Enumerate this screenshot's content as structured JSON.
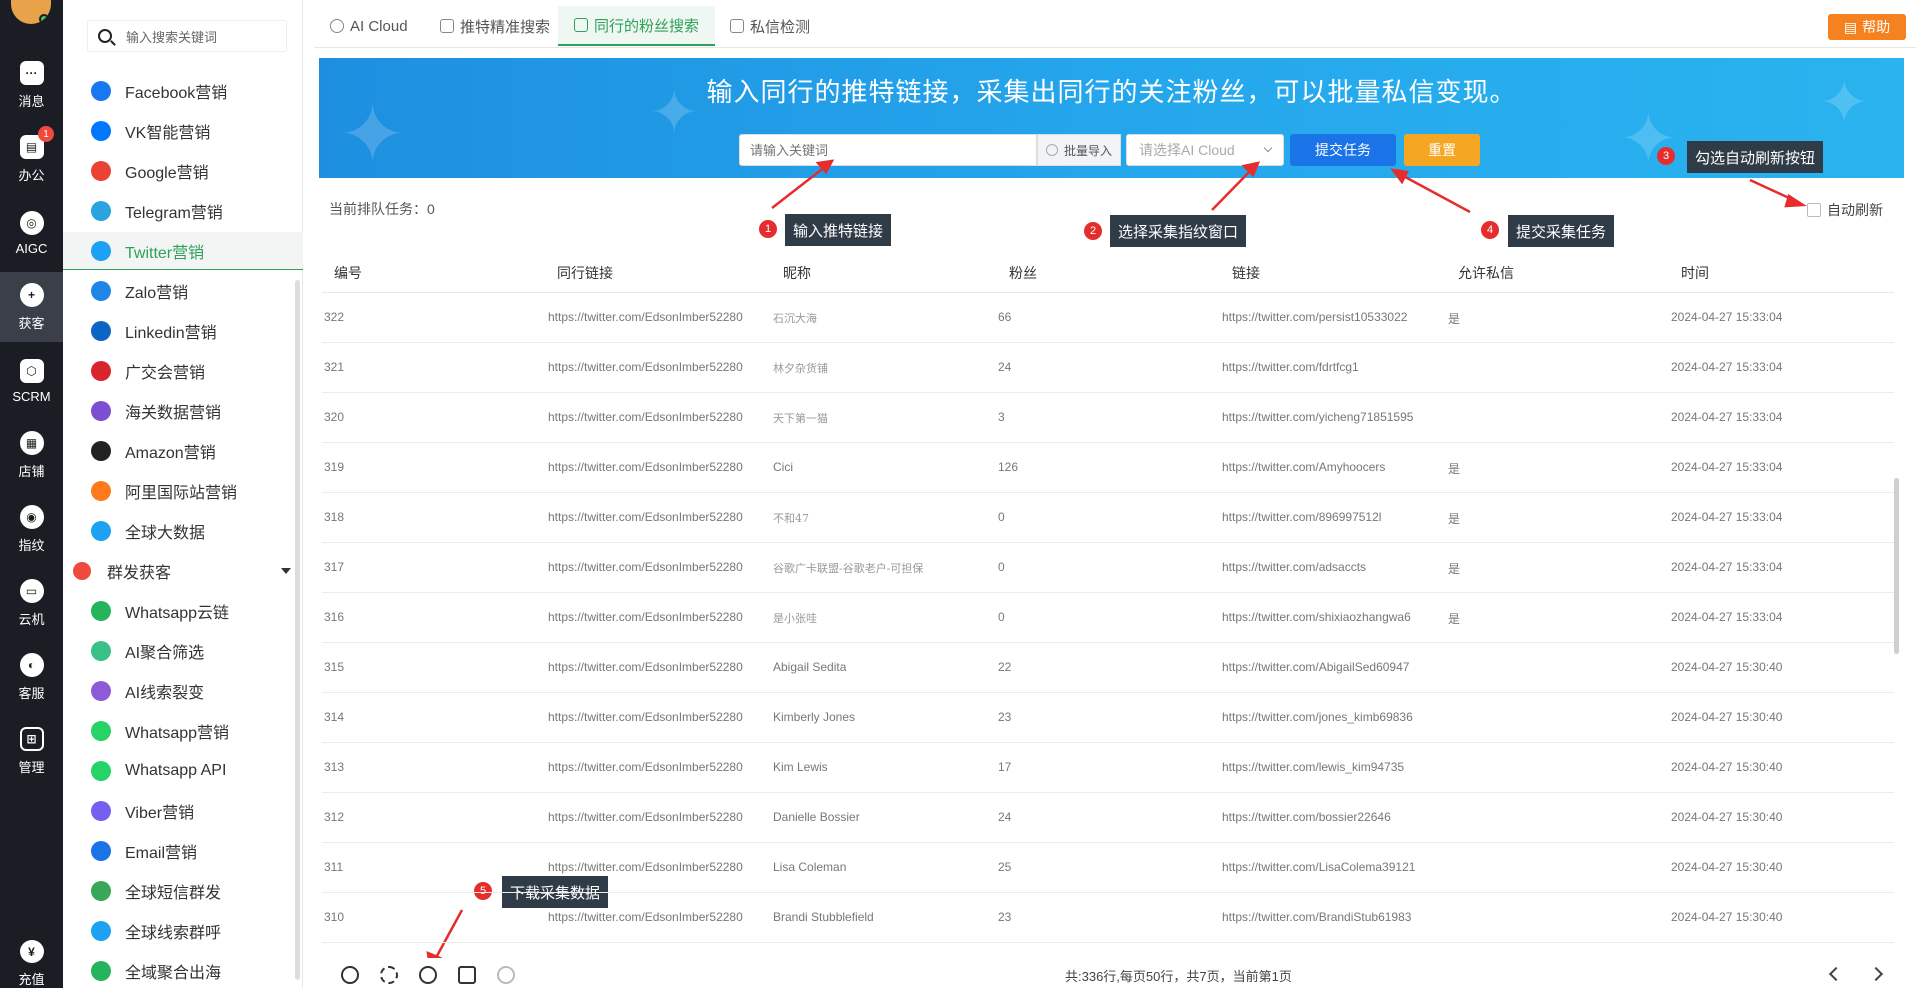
{
  "rail": {
    "items": [
      {
        "label": "消息"
      },
      {
        "label": "办公",
        "badge": "1"
      },
      {
        "label": "AIGC"
      },
      {
        "label": "获客"
      },
      {
        "label": "SCRM"
      },
      {
        "label": "店铺"
      },
      {
        "label": "指纹"
      },
      {
        "label": "云机"
      },
      {
        "label": "客服"
      },
      {
        "label": "管理"
      },
      {
        "label": "充值"
      }
    ]
  },
  "sidebar": {
    "search_placeholder": "输入搜索关键词",
    "items": [
      {
        "label": "Facebook营销",
        "icon": "facebook-icon",
        "color": "#1877f2"
      },
      {
        "label": "VK智能营销",
        "icon": "vk-icon",
        "color": "#0077ff"
      },
      {
        "label": "Google营销",
        "icon": "google-icon",
        "color": "#ea4335"
      },
      {
        "label": "Telegram营销",
        "icon": "telegram-icon",
        "color": "#2aa3df"
      },
      {
        "label": "Twitter营销",
        "icon": "twitter-icon",
        "color": "#1da1f2"
      },
      {
        "label": "Zalo营销",
        "icon": "zalo-icon",
        "color": "#1f86e8"
      },
      {
        "label": "Linkedin营销",
        "icon": "linkedin-icon",
        "color": "#0a66c2"
      },
      {
        "label": "广交会营销",
        "icon": "canton-fair-icon",
        "color": "#d9232d"
      },
      {
        "label": "海关数据营销",
        "icon": "customs-data-icon",
        "color": "#7a4fd4"
      },
      {
        "label": "Amazon营销",
        "icon": "amazon-icon",
        "color": "#222222"
      },
      {
        "label": "阿里国际站营销",
        "icon": "alibaba-icon",
        "color": "#ff7a1a"
      },
      {
        "label": "全球大数据",
        "icon": "big-data-icon",
        "color": "#1da1f2"
      }
    ],
    "group_label": "群发获客",
    "group_items": [
      {
        "label": "Whatsapp云链",
        "icon": "whatsapp-cloud-icon",
        "color": "#25b35c"
      },
      {
        "label": "AI聚合筛选",
        "icon": "ai-filter-icon",
        "color": "#3cc08a"
      },
      {
        "label": "AI线索裂变",
        "icon": "ai-lead-icon",
        "color": "#8e5bd8"
      },
      {
        "label": "Whatsapp营销",
        "icon": "whatsapp-icon",
        "color": "#25d366"
      },
      {
        "label": "Whatsapp API",
        "icon": "whatsapp-api-icon",
        "color": "#25d366"
      },
      {
        "label": "Viber营销",
        "icon": "viber-icon",
        "color": "#7360f2"
      },
      {
        "label": "Email营销",
        "icon": "email-icon",
        "color": "#1a74e8"
      },
      {
        "label": "全球短信群发",
        "icon": "sms-icon",
        "color": "#3aa757"
      },
      {
        "label": "全球线索群呼",
        "icon": "call-icon",
        "color": "#1da1f2"
      },
      {
        "label": "全域聚合出海",
        "icon": "global-icon",
        "color": "#25b35c"
      }
    ]
  },
  "tabs": [
    {
      "label": "AI Cloud"
    },
    {
      "label": "推特精准搜索"
    },
    {
      "label": "同行的粉丝搜索"
    },
    {
      "label": "私信检测"
    }
  ],
  "help_label": "帮助",
  "banner": {
    "title": "输入同行的推特链接，采集出同行的关注粉丝，可以批量私信变现。",
    "input_placeholder": "请输入关键词",
    "batch_import": "批量导入",
    "select_placeholder": "请选择AI Cloud",
    "submit": "提交任务",
    "reset": "重置"
  },
  "queue_label": "当前排队任务：0",
  "auto_refresh_label": "自动刷新",
  "annotations": [
    {
      "num": "1",
      "text": "输入推特链接"
    },
    {
      "num": "2",
      "text": "选择采集指纹窗口"
    },
    {
      "num": "3",
      "text": "勾选自动刷新按钮"
    },
    {
      "num": "4",
      "text": "提交采集任务"
    },
    {
      "num": "5",
      "text": "下载采集数据"
    }
  ],
  "table": {
    "headers": [
      "编号",
      "同行链接",
      "昵称",
      "粉丝",
      "链接",
      "允许私信",
      "时间"
    ],
    "rows": [
      [
        "322",
        "https://twitter.com/EdsonImber52280",
        "石沉大海",
        "66",
        "https://twitter.com/persist10533022",
        "是",
        "2024-04-27 15:33:04"
      ],
      [
        "321",
        "https://twitter.com/EdsonImber52280",
        "林夕杂货铺",
        "24",
        "https://twitter.com/fdrtfcg1",
        "",
        "2024-04-27 15:33:04"
      ],
      [
        "320",
        "https://twitter.com/EdsonImber52280",
        "天下第一猫",
        "3",
        "https://twitter.com/yicheng71851595",
        "",
        "2024-04-27 15:33:04"
      ],
      [
        "319",
        "https://twitter.com/EdsonImber52280",
        "Cici",
        "126",
        "https://twitter.com/Amyhoocers",
        "是",
        "2024-04-27 15:33:04"
      ],
      [
        "318",
        "https://twitter.com/EdsonImber52280",
        "不和47",
        "0",
        "https://twitter.com/896997512l",
        "是",
        "2024-04-27 15:33:04"
      ],
      [
        "317",
        "https://twitter.com/EdsonImber52280",
        "谷歌广卡联盟-谷歌老户-可担保",
        "0",
        "https://twitter.com/adsaccts",
        "是",
        "2024-04-27 15:33:04"
      ],
      [
        "316",
        "https://twitter.com/EdsonImber52280",
        "是小张哇",
        "0",
        "https://twitter.com/shixiaozhangwa6",
        "是",
        "2024-04-27 15:33:04"
      ],
      [
        "315",
        "https://twitter.com/EdsonImber52280",
        "Abigail Sedita",
        "22",
        "https://twitter.com/AbigailSed60947",
        "",
        "2024-04-27 15:30:40"
      ],
      [
        "314",
        "https://twitter.com/EdsonImber52280",
        "Kimberly Jones",
        "23",
        "https://twitter.com/jones_kimb69836",
        "",
        "2024-04-27 15:30:40"
      ],
      [
        "313",
        "https://twitter.com/EdsonImber52280",
        "Kim Lewis",
        "17",
        "https://twitter.com/lewis_kim94735",
        "",
        "2024-04-27 15:30:40"
      ],
      [
        "312",
        "https://twitter.com/EdsonImber52280",
        "Danielle Bossier",
        "24",
        "https://twitter.com/bossier22646",
        "",
        "2024-04-27 15:30:40"
      ],
      [
        "311",
        "https://twitter.com/EdsonImber52280",
        "Lisa Coleman",
        "25",
        "https://twitter.com/LisaColema39121",
        "",
        "2024-04-27 15:30:40"
      ],
      [
        "310",
        "https://twitter.com/EdsonImber52280",
        "Brandi Stubblefield",
        "23",
        "https://twitter.com/BrandiStub61983",
        "",
        "2024-04-27 15:30:40"
      ]
    ]
  },
  "pager_text": "共:336行,每页50行，共7页，当前第1页",
  "colors": {
    "accent": "#2fa05a",
    "banner": "#24a6ec",
    "primary": "#1a74e8",
    "warn": "#f5a623",
    "help": "#f5821f"
  }
}
